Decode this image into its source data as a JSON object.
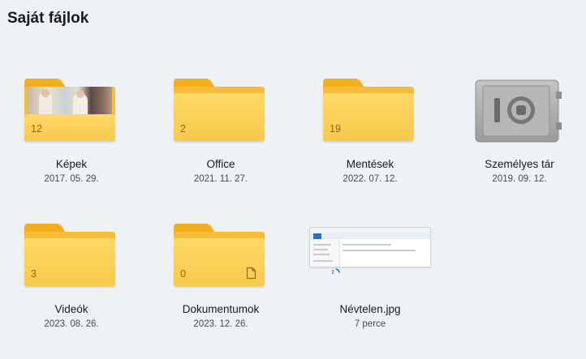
{
  "page": {
    "title": "Saját fájlok"
  },
  "items": [
    {
      "name": "Képek",
      "date": "2017. 05. 29.",
      "count": "12",
      "type": "folder-photo"
    },
    {
      "name": "Office",
      "date": "2021. 11. 27.",
      "count": "2",
      "type": "folder"
    },
    {
      "name": "Mentések",
      "date": "2022. 07. 12.",
      "count": "19",
      "type": "folder"
    },
    {
      "name": "Személyes tár",
      "date": "2019. 09. 12.",
      "type": "vault"
    },
    {
      "name": "Videók",
      "date": "2023. 08. 26.",
      "count": "3",
      "type": "folder"
    },
    {
      "name": "Dokumentumok",
      "date": "2023. 12. 26.",
      "count": "0",
      "type": "folder-doc"
    },
    {
      "name": "Névtelen.jpg",
      "date": "7 perce",
      "type": "image-file"
    }
  ],
  "colors": {
    "folder_front": "#ffd966",
    "folder_back": "#f2ae1f",
    "background": "#eef1f6",
    "vault": "#a9a9a9"
  }
}
